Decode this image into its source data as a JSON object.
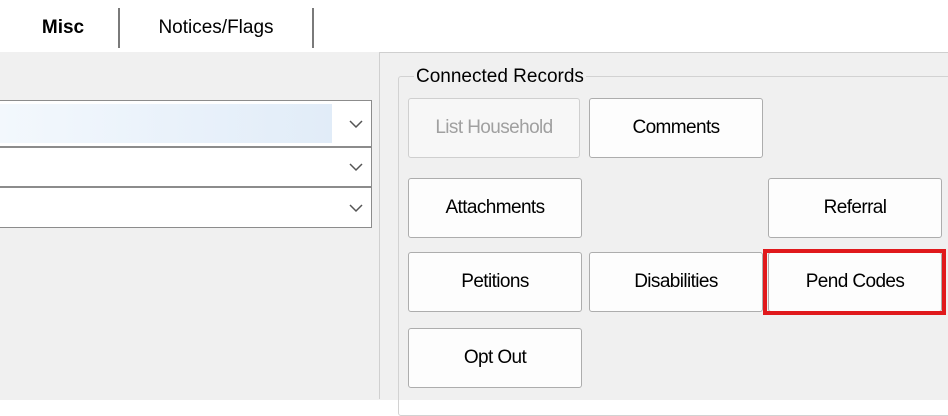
{
  "tabs": [
    {
      "label": "Misc",
      "active": true
    },
    {
      "label": "Notices/Flags",
      "active": false
    }
  ],
  "connected_records": {
    "title": "Connected Records",
    "buttons": {
      "list_household": "List Household",
      "comments": "Comments",
      "attachments": "Attachments",
      "referral": "Referral",
      "petitions": "Petitions",
      "disabilities": "Disabilities",
      "pend_codes": "Pend Codes",
      "opt_out": "Opt Out"
    }
  },
  "combos": [
    {
      "value": "",
      "focused": true
    },
    {
      "value": "",
      "focused": false
    },
    {
      "value": "",
      "focused": false
    }
  ],
  "colors": {
    "highlight": "#e0191c",
    "panel_bg": "#f0f0f0"
  },
  "icons": {
    "combo_arrow": "chevron-down-icon"
  }
}
